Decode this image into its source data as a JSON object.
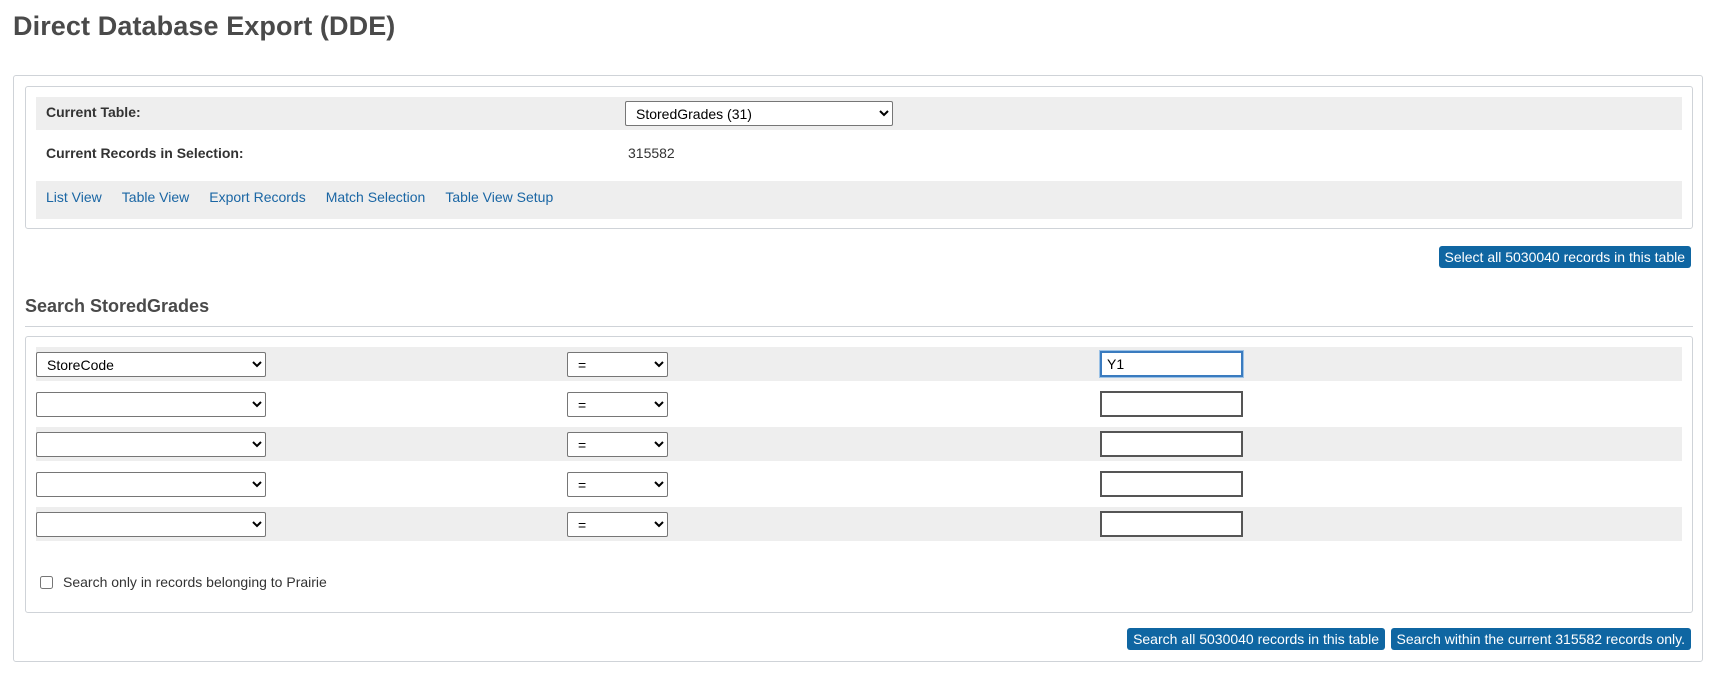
{
  "page": {
    "title": "Direct Database Export (DDE)"
  },
  "info": {
    "current_table_label": "Current Table:",
    "current_table_value": "StoredGrades (31)",
    "records_label": "Current Records in Selection:",
    "records_value": "315582"
  },
  "nav": {
    "links": [
      "List View",
      "Table View",
      "Export Records",
      "Match Selection",
      "Table View Setup"
    ]
  },
  "buttons": {
    "select_all": "Select all 5030040 records in this table",
    "search_all": "Search all 5030040 records in this table",
    "search_within": "Search within the current 315582 records only."
  },
  "search": {
    "title": "Search StoredGrades",
    "rows": [
      {
        "field": "StoreCode",
        "operator": "=",
        "value": "Y1"
      },
      {
        "field": "",
        "operator": "=",
        "value": ""
      },
      {
        "field": "",
        "operator": "=",
        "value": ""
      },
      {
        "field": "",
        "operator": "=",
        "value": ""
      },
      {
        "field": "",
        "operator": "=",
        "value": ""
      }
    ],
    "checkbox_label": "Search only in records belonging to Prairie",
    "checkbox_checked": false
  },
  "colors": {
    "button_bg": "#0f66a2",
    "link": "#1a66a4",
    "row_shade": "#eeeeee"
  }
}
